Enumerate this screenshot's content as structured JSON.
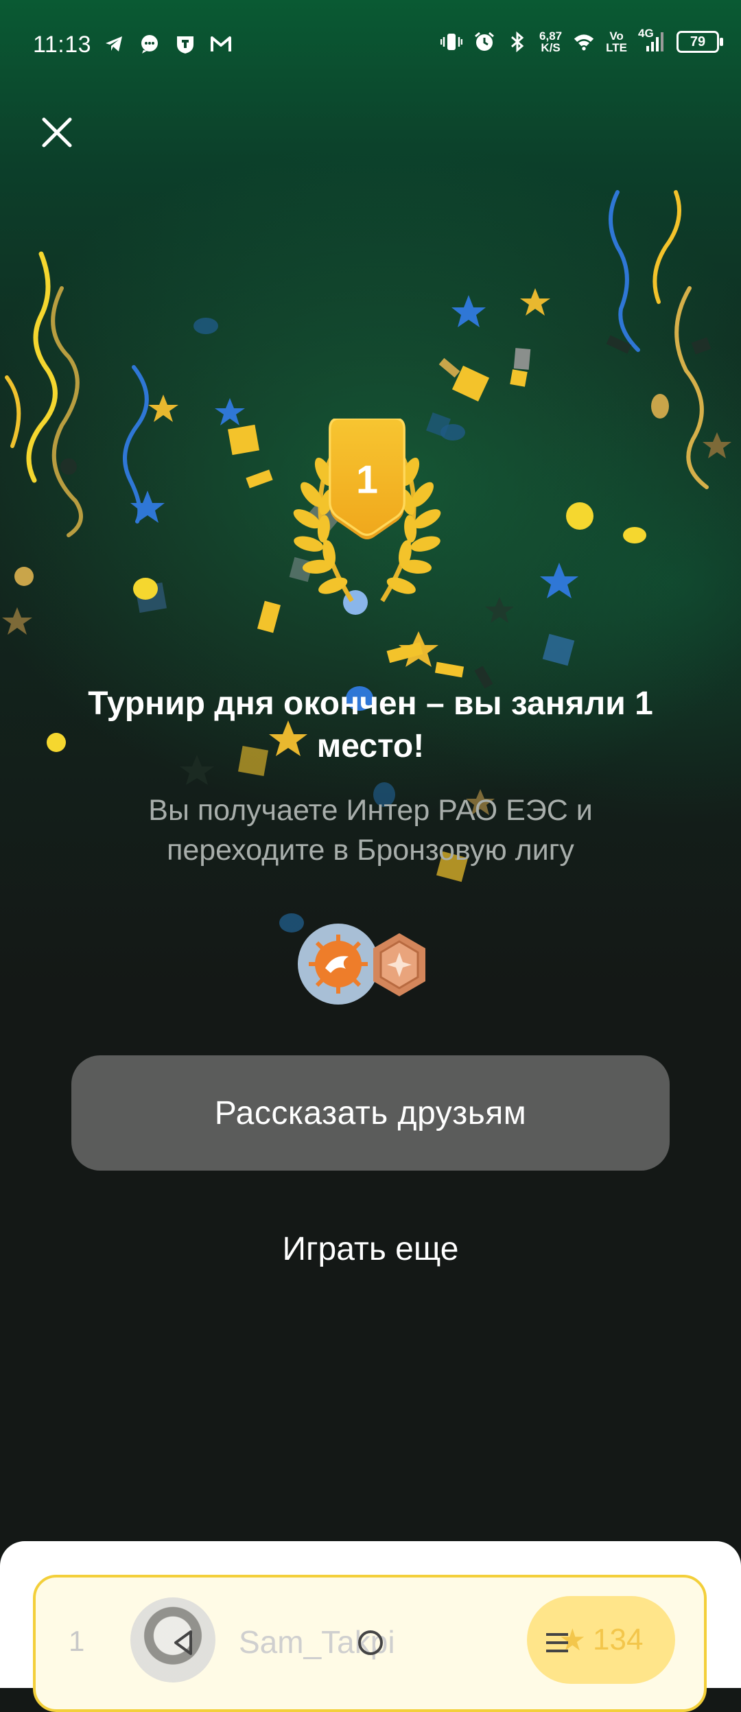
{
  "status_bar": {
    "time": "11:13",
    "net_speed_value": "6,87",
    "net_speed_unit": "K/S",
    "volte_top": "Vo",
    "volte_bottom": "LTE",
    "network_type": "4G",
    "battery_level": "79",
    "left_icons": [
      "telegram-icon",
      "chat-bubble-icon",
      "shield-app-icon",
      "gmail-icon"
    ],
    "right_icons": [
      "vibrate-icon",
      "alarm-icon",
      "bluetooth-icon",
      "wifi-icon",
      "signal-icon"
    ]
  },
  "dialog": {
    "close_icon": "close-icon",
    "place_number": "1",
    "title": "Турнир дня окончен – вы заняли 1 место!",
    "subtitle": "Вы получаете Интер РАО ЕЭС и переходите в Бронзовую лигу",
    "rewards": [
      "company-logo-icon",
      "bronze-league-icon"
    ],
    "share_button": "Рассказать друзьям",
    "play_again_button": "Играть еще"
  },
  "leaderboard_row": {
    "rank": "1",
    "name": "Sam_Takpi",
    "score": "134"
  },
  "nav_bar": {
    "icons": [
      "back-icon",
      "home-icon",
      "menu-icon"
    ]
  },
  "colors": {
    "accent_gold": "#f3c32b",
    "button_gray": "#5b5c5b",
    "background_dark": "#141816",
    "background_green": "#0a5a33"
  }
}
